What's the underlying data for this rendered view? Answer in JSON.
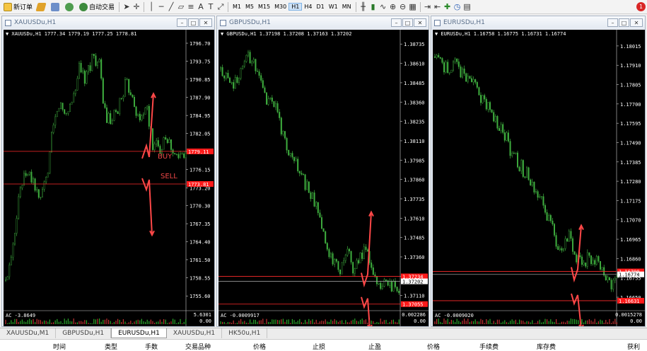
{
  "toolbar": {
    "new_order": "新订单",
    "auto_trading": "自动交易",
    "timeframes": [
      {
        "label": "M1",
        "active": false
      },
      {
        "label": "M5",
        "active": false
      },
      {
        "label": "M15",
        "active": false
      },
      {
        "label": "M30",
        "active": false
      },
      {
        "label": "H1",
        "active": true
      },
      {
        "label": "H4",
        "active": false
      },
      {
        "label": "D1",
        "active": false
      },
      {
        "label": "W1",
        "active": false
      },
      {
        "label": "MN",
        "active": false
      }
    ],
    "alert_count": "1"
  },
  "charts": [
    {
      "window_title": "XAUUSDu,H1",
      "info": "XAUUSDu,H1  1777.34 1779.19 1777.25 1778.81",
      "axis_labels": [
        "1796.70",
        "1793.75",
        "1790.85",
        "1787.90",
        "1784.95",
        "1782.05",
        "1779.10",
        "1776.15",
        "1773.20",
        "1770.30",
        "1767.35",
        "1764.40",
        "1761.50",
        "1758.55",
        "1755.60"
      ],
      "ymin": 1753.9,
      "ymax": 1798.2,
      "price_tags": [
        {
          "value": "1779.11",
          "price": 1779.11
        },
        {
          "value": "1773.81",
          "price": 1773.81
        }
      ],
      "ac_label": "AC -3.8649",
      "ac_top": "5.6301",
      "ac_bottom": "0.00",
      "annotations": [
        "BUY",
        "SELL"
      ],
      "colors": {
        "candle": "#3fae3f",
        "line": "#ff2b2b",
        "tag": "#ff1a1a",
        "arrow": "#ff4848"
      }
    },
    {
      "window_title": "GBPUSDu,H1",
      "info": "GBPUSDu,H1  1.37198 1.37208 1.37163 1.37202",
      "axis_labels": [
        "1.38735",
        "1.38610",
        "1.38485",
        "1.38360",
        "1.38235",
        "1.38110",
        "1.37985",
        "1.37860",
        "1.37735",
        "1.37610",
        "1.37485",
        "1.37360",
        "1.37235",
        "1.37110"
      ],
      "ymin": 1.3704,
      "ymax": 1.388,
      "price_tags": [
        {
          "value": "1.37234",
          "price": 1.37234
        },
        {
          "value": "1.37202",
          "price": 1.37202
        },
        {
          "value": "1.37055",
          "price": 1.37055
        }
      ],
      "ac_label": "AC -0.0009917",
      "ac_top": "0.002286",
      "ac_bottom": "0.00"
    },
    {
      "window_title": "EURUSDu,H1",
      "info": "EURUSDu,H1  1.16758 1.16775 1.16731 1.16774",
      "axis_labels": [
        "1.18015",
        "1.17910",
        "1.17805",
        "1.17700",
        "1.17595",
        "1.17490",
        "1.17385",
        "1.17280",
        "1.17175",
        "1.17070",
        "1.16965",
        "1.16860",
        "1.16755",
        "1.16650"
      ],
      "ymin": 1.166,
      "ymax": 1.1808,
      "price_tags": [
        {
          "value": "1.16790",
          "price": 1.1679
        },
        {
          "value": "1.16774",
          "price": 1.16774
        },
        {
          "value": "1.16631",
          "price": 1.16631
        }
      ],
      "ac_label": "AC -0.0009020",
      "ac_top": "0.0015278",
      "ac_bottom": "0.00"
    }
  ],
  "tabs": [
    {
      "label": "XAUUSDu,M1",
      "active": false
    },
    {
      "label": "GBPUSDu,H1",
      "active": false
    },
    {
      "label": "EURUSDu,H1",
      "active": true
    },
    {
      "label": "XAUUSDu,H1",
      "active": false
    },
    {
      "label": "HK50u,H1",
      "active": false
    }
  ],
  "terminal_headers": [
    "时间",
    "类型",
    "手数",
    "交易品种",
    "价格",
    "止损",
    "止盈",
    "价格",
    "手续费",
    "库存费",
    "获利"
  ]
}
